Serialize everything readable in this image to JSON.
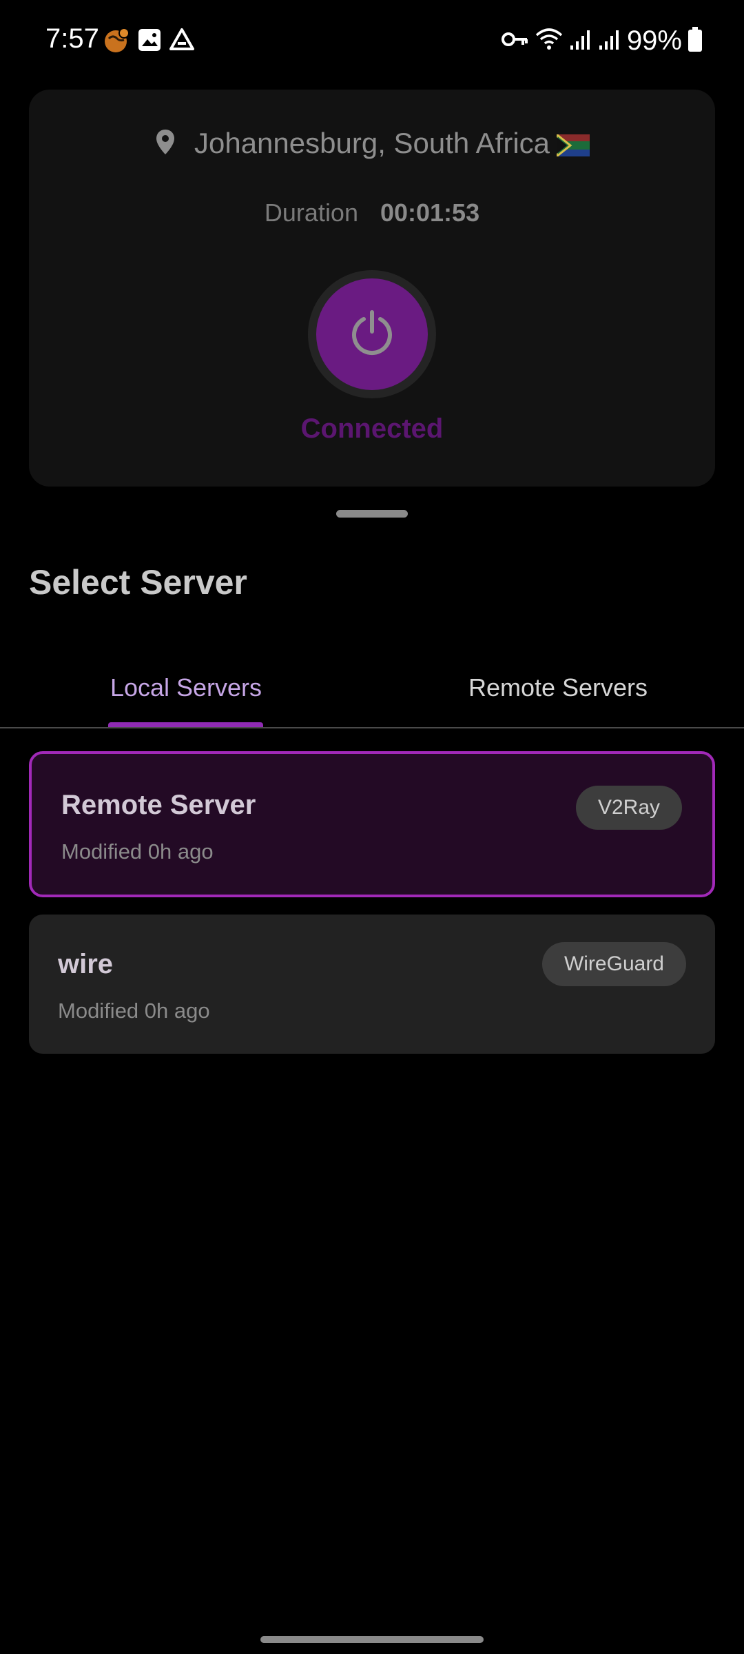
{
  "status_bar": {
    "time": "7:57",
    "battery": "99%",
    "left_icons": [
      "vpn-globe-icon",
      "gallery-icon",
      "drive-icon"
    ],
    "right_icons": [
      "vpn-key-icon",
      "wifi-icon",
      "signal-icon",
      "signal-icon",
      "battery-icon"
    ]
  },
  "connection": {
    "location": "Johannesburg, South Africa",
    "duration_label": "Duration",
    "duration_value": "00:01:53",
    "status": "Connected"
  },
  "section": {
    "title": "Select Server"
  },
  "tabs": [
    {
      "label": "Local Servers",
      "selected": true
    },
    {
      "label": "Remote Servers",
      "selected": false
    }
  ],
  "servers": [
    {
      "name": "Remote Server",
      "modified": "Modified 0h ago",
      "protocol": "V2Ray",
      "selected": true
    },
    {
      "name": "wire",
      "modified": "Modified 0h ago",
      "protocol": "WireGuard",
      "selected": false
    }
  ],
  "colors": {
    "accent": "#a129b8",
    "power_button": "#6a1b82",
    "selected_card_bg": "#230a25"
  }
}
